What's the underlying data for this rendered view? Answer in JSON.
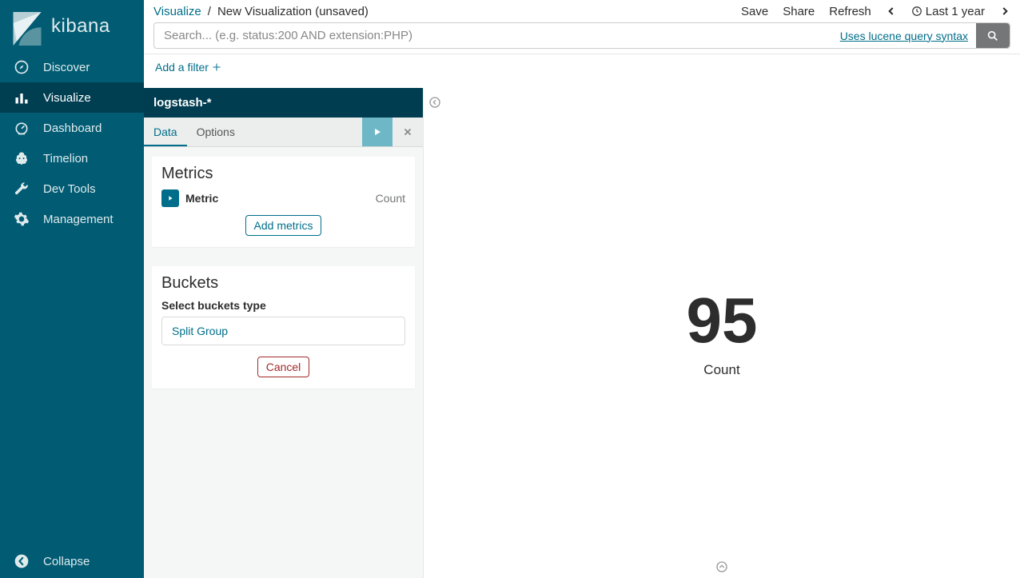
{
  "brand": {
    "name": "kibana"
  },
  "sidebar": {
    "items": [
      {
        "label": "Discover",
        "icon": "compass-icon"
      },
      {
        "label": "Visualize",
        "icon": "bar-chart-icon"
      },
      {
        "label": "Dashboard",
        "icon": "dashboard-icon"
      },
      {
        "label": "Timelion",
        "icon": "timelion-icon"
      },
      {
        "label": "Dev Tools",
        "icon": "wrench-icon"
      },
      {
        "label": "Management",
        "icon": "gear-icon"
      }
    ],
    "collapse_label": "Collapse"
  },
  "breadcrumb": {
    "root": "Visualize",
    "sep": "/",
    "current": "New Visualization (unsaved)"
  },
  "top_actions": {
    "save": "Save",
    "share": "Share",
    "refresh": "Refresh",
    "timepicker": "Last 1 year"
  },
  "search": {
    "placeholder": "Search... (e.g. status:200 AND extension:PHP)",
    "value": "",
    "lucene_hint": "Uses lucene query syntax"
  },
  "filters": {
    "add_filter_label": "Add a filter"
  },
  "editor": {
    "index_pattern": "logstash-*",
    "tabs": {
      "data": "Data",
      "options": "Options"
    },
    "metrics": {
      "heading": "Metrics",
      "row_label": "Metric",
      "row_value": "Count",
      "add_label": "Add metrics"
    },
    "buckets": {
      "heading": "Buckets",
      "select_label": "Select buckets type",
      "split_group": "Split Group",
      "cancel_label": "Cancel"
    }
  },
  "viz": {
    "number": "95",
    "label": "Count"
  }
}
